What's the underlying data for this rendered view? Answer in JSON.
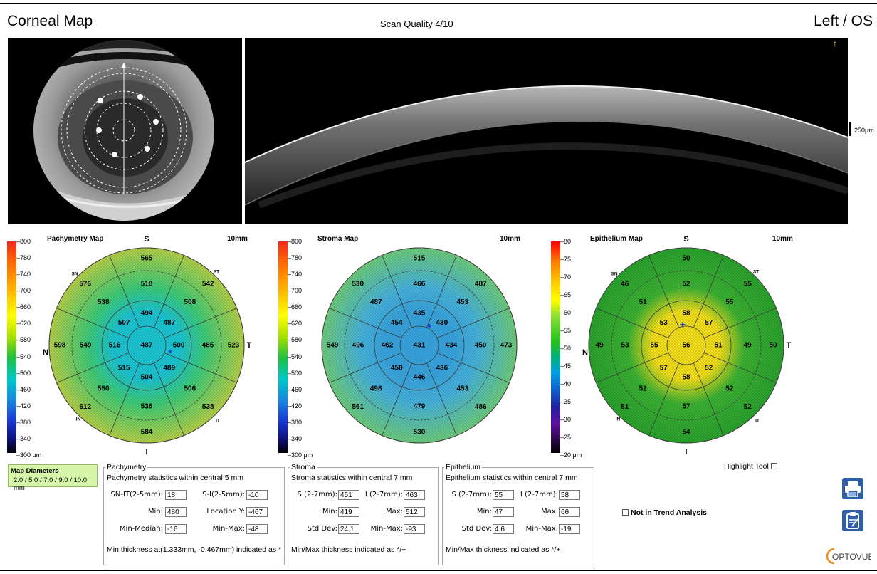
{
  "header": {
    "title": "Corneal Map",
    "quality": "Scan Quality 4/10",
    "eye": "Left / OS"
  },
  "bscan": {
    "scale_label": "250μm"
  },
  "colors": {
    "accent": "#2e5fa8",
    "panel_green": "#d6f5a8"
  },
  "maps": [
    {
      "id": "pachy",
      "title": "Pachymetry Map",
      "scale": "10mm",
      "bar": {
        "ticks": [
          "800",
          "780",
          "740",
          "700",
          "660",
          "620",
          "580",
          "540",
          "500",
          "460",
          "420",
          "380",
          "340",
          "300 μm"
        ]
      },
      "compass": {
        "S": "S",
        "I": "I",
        "N": "N",
        "T": "T",
        "SN": "SN",
        "ST": "ST",
        "IN": "IN",
        "IT": "IT"
      },
      "values": {
        "c": "487",
        "r1": [
          "494",
          "487",
          "500",
          "489",
          "504",
          "515",
          "516",
          "507"
        ],
        "r2": [
          "518",
          "508",
          "485",
          "506",
          "536",
          "550",
          "549",
          "538"
        ],
        "r3": [
          "565",
          "542",
          "523",
          "538",
          "584",
          "612",
          "598",
          "576"
        ]
      },
      "mark": "*"
    },
    {
      "id": "stroma",
      "title": "Stroma Map",
      "scale": "10mm",
      "bar": {
        "ticks": [
          "800",
          "780",
          "740",
          "700",
          "660",
          "620",
          "580",
          "540",
          "500",
          "460",
          "420",
          "380",
          "340",
          "300 μm"
        ]
      },
      "compass": null,
      "values": {
        "c": "431",
        "r1": [
          "435",
          "430",
          "434",
          "436",
          "446",
          "458",
          "462",
          "454"
        ],
        "r2": [
          "466",
          "453",
          "450",
          "453",
          "479",
          "498",
          "496",
          "487"
        ],
        "r3": [
          "515",
          "487",
          "473",
          "486",
          "530",
          "561",
          "549",
          "530"
        ]
      },
      "mark": "*"
    },
    {
      "id": "epi",
      "title": "Epithelium Map",
      "scale": "10mm",
      "bar": {
        "ticks": [
          "80",
          "75",
          "70",
          "65",
          "60",
          "55",
          "50",
          "45",
          "40",
          "35",
          "30",
          "25",
          "20 μm"
        ]
      },
      "compass": {
        "S": "S",
        "I": "I",
        "N": "N",
        "T": "T",
        "SN": "SN",
        "ST": "ST",
        "IN": "IN",
        "IT": "IT"
      },
      "values": {
        "c": "56",
        "r1": [
          "58",
          "57",
          "51",
          "52",
          "58",
          "57",
          "55",
          "53"
        ],
        "r2": [
          "52",
          "55",
          "49",
          "52",
          "57",
          "52",
          "53",
          "51"
        ],
        "r3": [
          "50",
          "55",
          "50",
          "52",
          "54",
          "51",
          "49",
          "46"
        ]
      },
      "mark": "+"
    }
  ],
  "map_diameters": {
    "title": "Map Diameters",
    "values": "2.0 / 5.0 / 7.0 / 9.0 / 10.0 mm"
  },
  "pachymetry": {
    "legend": "Pachymetry",
    "desc": "Pachymetry statistics within central 5 mm",
    "sn_it_label": "SN-IT(2-5mm):",
    "sn_it": "18",
    "s_i_label": "S-I(2-5mm):",
    "s_i": "-10",
    "min_label": "Min:",
    "min": "480",
    "loc_y_label": "Location Y:",
    "loc_y": "-467",
    "min_median_label": "Min-Median:",
    "min_median": "-16",
    "min_max_label": "Min-Max:",
    "min_max": "-48",
    "note": "Min thickness at(1.333mm, -0.467mm) indicated as *"
  },
  "stroma": {
    "legend": "Stroma",
    "desc": "Stroma statistics within central 7 mm",
    "s_label": "S (2-7mm):",
    "s": "451",
    "i_label": "I (2-7mm):",
    "i": "463",
    "min_label": "Min:",
    "min": "419",
    "max_label": "Max:",
    "max": "512",
    "std_label": "Std Dev:",
    "std": "24.1",
    "min_max_label": "Min-Max:",
    "min_max": "-93",
    "note": "Min/Max thickness indicated as */+"
  },
  "epithelium": {
    "legend": "Epithelium",
    "desc": "Epithelium statistics within central 7 mm",
    "s_label": "S (2-7mm):",
    "s": "55",
    "i_label": "I (2-7mm):",
    "i": "58",
    "min_label": "Min:",
    "min": "47",
    "max_label": "Max:",
    "max": "66",
    "std_label": "Std Dev:",
    "std": "4.6",
    "min_max_label": "Min-Max:",
    "min_max": "-19",
    "note": "Min/Max thickness indicated as */+"
  },
  "options": {
    "highlight_tool": "Highlight Tool",
    "not_in_trend": "Not in Trend Analysis"
  },
  "icons": {
    "print": "printer-icon",
    "report": "clipboard-icon"
  },
  "brand": "OPTOVUE"
}
